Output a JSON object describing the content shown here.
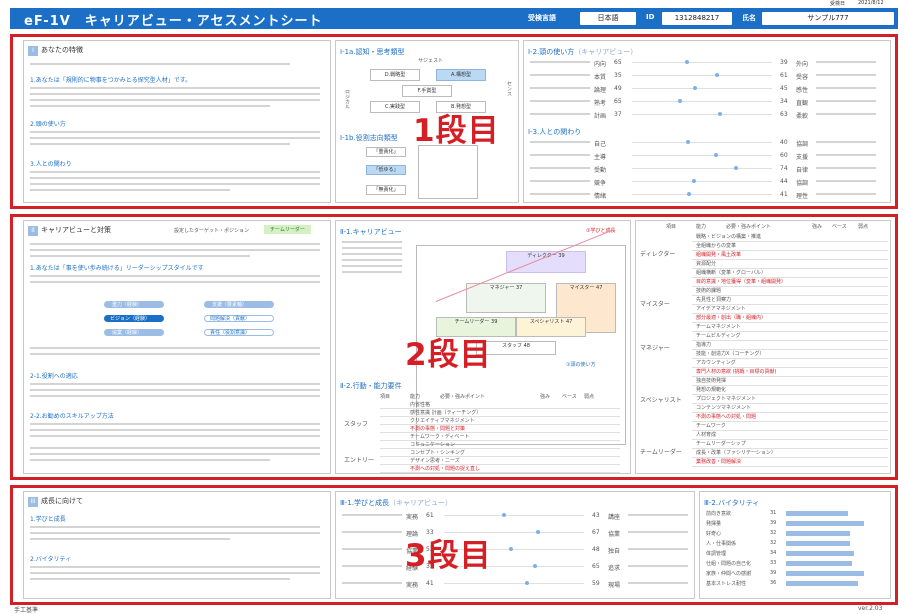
{
  "meta": {
    "receipt_label": "受検日",
    "receipt_date": "2021/8/12"
  },
  "header": {
    "title": "eF-1V　キャリアビュー・アセスメントシート",
    "lang_label": "受検言語",
    "lang_value": "日本語",
    "id_label": "ID",
    "id_value": "1312848217",
    "name_label": "氏名",
    "name_value": "サンプル777"
  },
  "sections": [
    {
      "label": "1段目"
    },
    {
      "label": "2段目"
    },
    {
      "label": "3段目"
    }
  ],
  "s1": {
    "p1_title": "あなたの特徴",
    "p1_heads": [
      "1.あなたは「規則的に物事をつかみとる探究型人材」です。",
      "2.頭の使い方",
      "3.人との関わり"
    ],
    "p2_title": "Ⅰ-1a.認知・思考類型",
    "p2_axis_top": "サジェスト",
    "p2_axis_left": "ロジカル",
    "p2_axis_right": "センス",
    "p2_boxes": [
      "D.戦略型",
      "A.構想型",
      "F.手賞型",
      "C.実践型",
      "B.発想型"
    ],
    "p2b_title": "Ⅰ-1b.役割志向類型",
    "p2b_rows": [
      "「重責化」",
      "「低ゆる」",
      "「無責化」"
    ],
    "p3_title": "Ⅰ-2.頭の使い方",
    "p3_tag": "（キャリアビュー）",
    "p3_left": [
      "内向",
      "本質",
      "論理",
      "熟考",
      "計画"
    ],
    "p3_right": [
      "外向",
      "受容",
      "感性",
      "直観",
      "柔軟"
    ],
    "p3_lnum": [
      "65",
      "35",
      "49",
      "65",
      "37"
    ],
    "p3_rnum": [
      "39",
      "61",
      "45",
      "34",
      "63"
    ],
    "p4_title": "Ⅰ-3.人との関わり",
    "p4_left": [
      "自己",
      "主導",
      "受動",
      "競争",
      "情緒"
    ],
    "p4_right": [
      "協調",
      "支援",
      "自律",
      "協調",
      "理性"
    ],
    "p4_rnum": [
      "40",
      "60",
      "74",
      "44",
      "41"
    ]
  },
  "s2": {
    "p1_title": "キャリアビューと対策",
    "p1_target_label": "設定したターゲット・ポジション",
    "p1_target_value": "チームリーダー",
    "p1_heads": [
      "1.あなたは「事を使い歩み続ける」リーダーシップスタイルです",
      "2-1.役割への適応",
      "2-2.お勧めのスキルアップ方法"
    ],
    "p1_tags": [
      "重力（経験）",
      "ビジョン（経験）",
      "協業（経験）",
      "支援（要素軸）",
      "問題解決（貢献）",
      "責任（役割意識）"
    ],
    "p2_title": "Ⅱ-1.キャリアビュー",
    "p2_legend_top": "①学びと成長",
    "p2_legend_bottom": "①頭の使い方",
    "p2_nodes": [
      {
        "label": "ディレクター",
        "val": "39"
      },
      {
        "label": "マネジャー",
        "val": "37"
      },
      {
        "label": "マイスター",
        "val": "47"
      },
      {
        "label": "チームリーダー",
        "val": "39"
      },
      {
        "label": "スペシャリスト",
        "val": "47"
      },
      {
        "label": "スタッフ",
        "val": "48"
      }
    ],
    "p3_title": "Ⅱ-2.行動・能力要件",
    "p3_cols": [
      "項目",
      "能力",
      "必要・強みポイント",
      "強み",
      "ベース",
      "弱点"
    ],
    "p3_groups": [
      "スタッフ",
      "エントリー"
    ],
    "p3_items": [
      "内省性格",
      "感性意識 計画（ティーチング）",
      "クリエイティブマネジメント",
      "不測の事態・問題と対策",
      "チームワーク・ディベート",
      "コミュニケーション",
      "コンセプト・シンキング",
      "デザイン思考・ニーズ",
      "不測への対処・問題の捉え直し"
    ],
    "p4_cols": [
      "項目",
      "能力",
      "必要・強みポイント",
      "強み",
      "ベース",
      "弱点"
    ],
    "p4_groups": [
      "ディレクター",
      "マイスター",
      "マネジャー",
      "スペシャリスト",
      "チームリーダー"
    ],
    "p4_items": [
      "戦略・ビジョンの構築・推進",
      "全組織からの変革",
      "組織開発・風土改革",
      "資源配分",
      "組織横断（変革・グローバル）",
      "目的意識・地位獲得（変革・組織開発）",
      "技術的課題",
      "先見性と洞察力",
      "アイデアマネジメント",
      "部分最適・創出（職・組織内）",
      "チームマネジメント",
      "チームビルディング",
      "指導力",
      "技能・創造力X（コーチング）",
      "アカウンティング",
      "専門人材の意欲 (挑戦・目標の貢献)",
      "独自技術発揮",
      "発想の規範化",
      "プロジェクトマネジメント",
      "コンテンツマネジメント",
      "不測の事態への対処・問題",
      "チームワーク",
      "人材育成",
      "チームリーダーシップ",
      "成長・改革（ファシリテーション）",
      "業務改善・問題解決"
    ]
  },
  "s3": {
    "p1_title": "成長に向けて",
    "p1_heads": [
      "1.学びと成長",
      "2.バイタリティ"
    ],
    "p2_title": "Ⅲ-1.学びと成長",
    "p2_tag": "（キャリアビュー）",
    "p2_left": [
      "実務",
      "理論",
      "協業",
      "経験",
      "実務"
    ],
    "p2_right": [
      "講座",
      "協業",
      "独自",
      "追求",
      "現場"
    ],
    "p2_lnum": [
      "61",
      "33",
      "52",
      "35",
      "41"
    ],
    "p2_rnum": [
      "43",
      "67",
      "48",
      "65",
      "59"
    ],
    "p3_title": "Ⅲ-2.バイタリティ",
    "p3_items": [
      {
        "label": "前向き意欲",
        "val": "31"
      },
      {
        "label": "発揮量",
        "val": "39"
      },
      {
        "label": "好奇心",
        "val": "32"
      },
      {
        "label": "人・仕事関係",
        "val": "32"
      },
      {
        "label": "体調管理",
        "val": "34"
      },
      {
        "label": "仕組・問題の自己化",
        "val": "33"
      },
      {
        "label": "家族・仲間への感謝",
        "val": "39"
      },
      {
        "label": "基本ストレス耐性",
        "val": "36"
      }
    ]
  },
  "footer": {
    "left": "手工基準",
    "right": "ver.2.03"
  }
}
